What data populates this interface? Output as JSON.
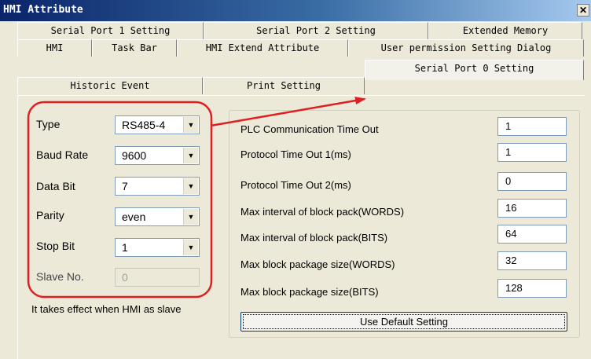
{
  "window": {
    "title": "HMI Attribute",
    "close_glyph": "✕"
  },
  "tabs": {
    "row1": [
      "Serial Port 1 Setting",
      "Serial Port 2 Setting",
      "Extended Memory"
    ],
    "row2": [
      "HMI",
      "Task Bar",
      "HMI Extend Attribute",
      "User permission Setting Dialog"
    ],
    "row3": [
      "Historic Event",
      "Print Setting",
      "Serial Port 0 Setting"
    ],
    "active": "Serial Port 0 Setting"
  },
  "serial_settings": [
    {
      "label": "Type",
      "value": "RS485-4"
    },
    {
      "label": "Baud Rate",
      "value": "9600"
    },
    {
      "label": "Data Bit",
      "value": "7"
    },
    {
      "label": "Parity",
      "value": "even"
    },
    {
      "label": "Stop Bit",
      "value": "1"
    },
    {
      "label": "Slave No.",
      "value": "0"
    }
  ],
  "slave_note": "It takes effect when HMI as slave",
  "parameters": [
    {
      "label": "PLC Communication Time Out",
      "value": "1"
    },
    {
      "label": "Protocol Time Out 1(ms)",
      "value": "1"
    },
    {
      "label": "Protocol Time Out 2(ms)",
      "value": "0"
    },
    {
      "label": "Max interval of block pack(WORDS)",
      "value": "16"
    },
    {
      "label": "Max interval of block pack(BITS)",
      "value": "64"
    },
    {
      "label": "Max block package size(WORDS)",
      "value": "32"
    },
    {
      "label": "Max block package size(BITS)",
      "value": "128"
    }
  ],
  "default_button": "Use Default Setting",
  "colors": {
    "annotation": "#e02020",
    "title_bar": "#0a246a",
    "dialog_bg": "#ece9d8"
  }
}
